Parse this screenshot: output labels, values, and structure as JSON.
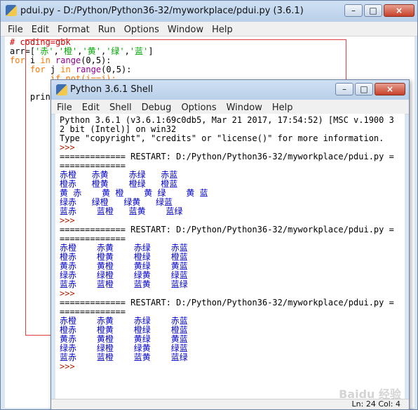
{
  "editor": {
    "title": "pdui.py - D:/Python/Python36-32/myworkplace/pdui.py (3.6.1)",
    "menu": [
      "File",
      "Edit",
      "Format",
      "Run",
      "Options",
      "Window",
      "Help"
    ],
    "code": {
      "line1": "# coding=gbk",
      "line2_a": "arr=[",
      "line2_s1": "'赤'",
      "line2_c1": ",",
      "line2_s2": "'橙'",
      "line2_c2": ",",
      "line2_s3": "'黄'",
      "line2_c3": ",",
      "line2_s4": "'绿'",
      "line2_c4": ",",
      "line2_s5": "'蓝'",
      "line2_end": "]",
      "line3_kw1": "for",
      "line3_a": " i ",
      "line3_kw2": "in",
      "line3_bi": " range",
      "line3_b": "(0,5):",
      "line4_ind": "    ",
      "line4_kw1": "for",
      "line4_a": " j ",
      "line4_kw2": "in",
      "line4_bi": " range",
      "line4_b": "(0,5):",
      "line5_part": "        if not(i==j):",
      "line6_part": "    prin"
    }
  },
  "shell": {
    "title": "Python 3.6.1 Shell",
    "menu": [
      "File",
      "Edit",
      "Shell",
      "Debug",
      "Options",
      "Window",
      "Help"
    ],
    "banner": [
      "Python 3.6.1 (v3.6.1:69c0db5, Mar 21 2017, 17:54:52) [MSC v.1900 3",
      "2 bit (Intel)] on win32",
      "Type \"copyright\", \"credits\" or \"license()\" for more information."
    ],
    "prompt": ">>>",
    "restart_line": "============= RESTART: D:/Python/Python36-32/myworkplace/pdui.py =",
    "restart_cont": "=============",
    "run1": [
      "赤橙   赤黄    赤绿   赤蓝",
      "橙赤   橙黄    橙绿   橙蓝",
      "黄 赤    黄 橙    黄 绿    黄 蓝",
      "绿赤   绿橙   绿黄   绿蓝",
      "蓝赤    蓝橙   蓝黄    蓝绿"
    ],
    "run2": [
      "赤橙    赤黄    赤绿    赤蓝",
      "橙赤    橙黄    橙绿    橙蓝",
      "黄赤    黄橙    黄绿    黄蓝",
      "绿赤    绿橙    绿黄    绿蓝",
      "蓝赤    蓝橙    蓝黄    蓝绿"
    ],
    "run3": [
      "赤橙    赤黄    赤绿    赤蓝",
      "橙赤    橙黄    橙绿    橙蓝",
      "黄赤    黄橙    黄绿    黄蓝",
      "绿赤    绿橙    绿黄    绿蓝",
      "蓝赤    蓝橙    蓝黄    蓝绿"
    ],
    "status": "Ln: 24   Col: 4"
  },
  "window_controls": {
    "minimize": "–",
    "maximize": "□",
    "close": "×"
  },
  "watermark": "Baidu 经验",
  "colors": {
    "keyword": "#ff7700",
    "comment": "#dd0000",
    "string": "#00aa00",
    "builtin": "#900090",
    "output": "#0000cc",
    "prompt": "#b02000",
    "highlight_box": "#e04040"
  }
}
